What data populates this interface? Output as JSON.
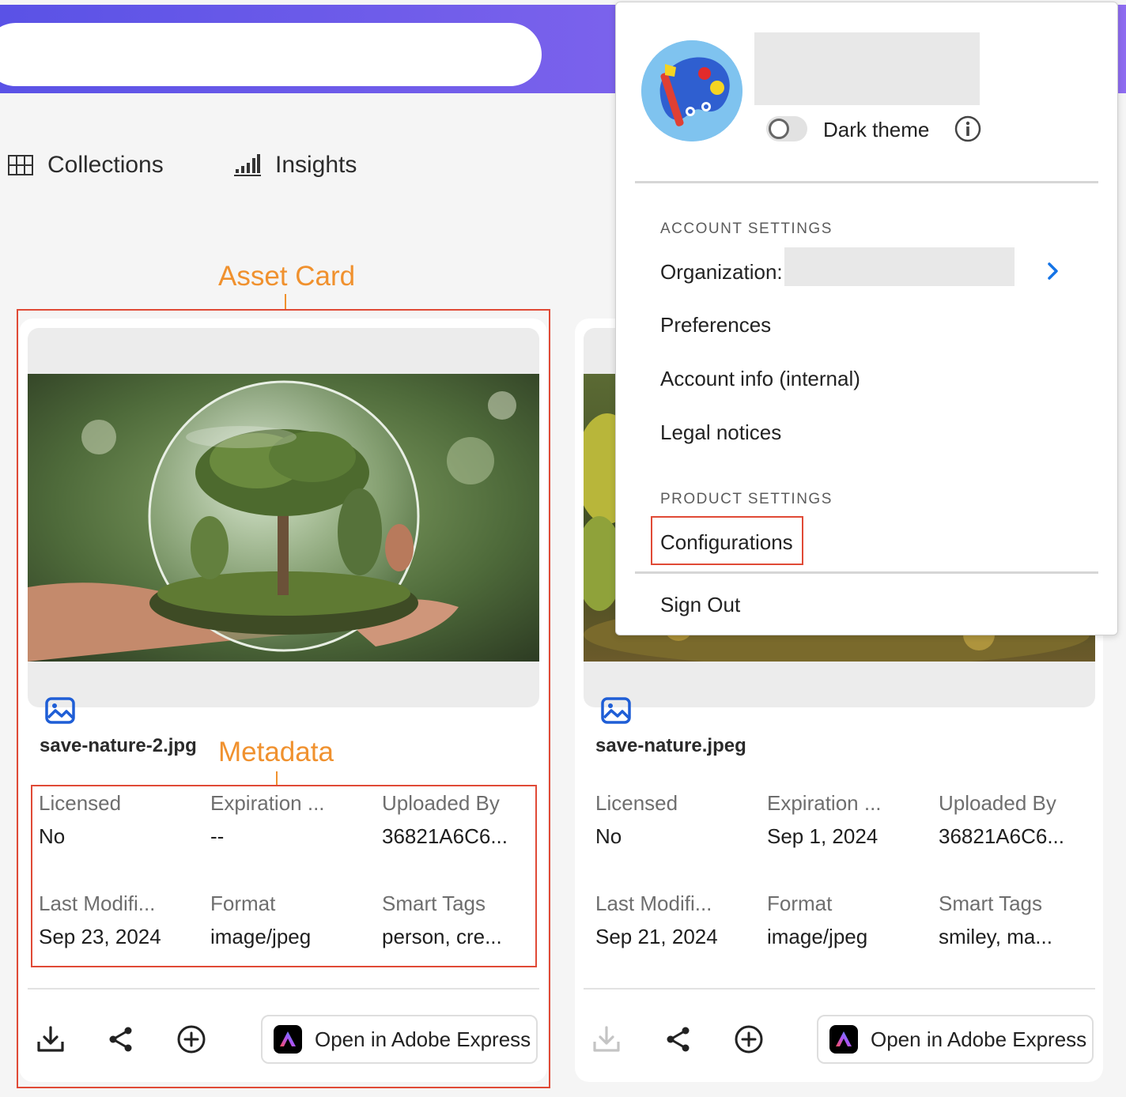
{
  "nav": {
    "collections": "Collections",
    "insights": "Insights"
  },
  "annotations": {
    "asset_card": "Asset Card",
    "metadata": "Metadata"
  },
  "cards": [
    {
      "filename": "save-nature-2.jpg",
      "meta": [
        {
          "label": "Licensed",
          "value": "No"
        },
        {
          "label": "Expiration ...",
          "value": "--"
        },
        {
          "label": "Uploaded By",
          "value": "36821A6C6..."
        },
        {
          "label": "Last Modifi...",
          "value": "Sep 23, 2024"
        },
        {
          "label": "Format",
          "value": "image/jpeg"
        },
        {
          "label": "Smart Tags",
          "value": "person, cre..."
        }
      ],
      "download_enabled": true,
      "express_label": "Open in Adobe Express"
    },
    {
      "filename": "save-nature.jpeg",
      "meta": [
        {
          "label": "Licensed",
          "value": "No"
        },
        {
          "label": "Expiration ...",
          "value": "Sep 1, 2024"
        },
        {
          "label": "Uploaded By",
          "value": "36821A6C6..."
        },
        {
          "label": "Last Modifi...",
          "value": "Sep 21, 2024"
        },
        {
          "label": "Format",
          "value": "image/jpeg"
        },
        {
          "label": "Smart Tags",
          "value": "smiley, ma..."
        }
      ],
      "download_enabled": false,
      "express_label": "Open in Adobe Express"
    }
  ],
  "menu": {
    "dark_theme_label": "Dark theme",
    "dark_theme_on": false,
    "account_settings_heading": "ACCOUNT SETTINGS",
    "organization_label": "Organization:",
    "preferences": "Preferences",
    "account_info": "Account info (internal)",
    "legal_notices": "Legal notices",
    "product_settings_heading": "PRODUCT SETTINGS",
    "configurations": "Configurations",
    "sign_out": "Sign Out"
  },
  "colors": {
    "topbar_gradient_start": "#5a52e6",
    "topbar_gradient_end": "#8e6cf0",
    "annotation_orange": "#f0912e",
    "highlight_red": "#e04a36",
    "link_blue": "#1473e6",
    "icon_blue": "#1f5ed6"
  },
  "icons": [
    "grid-icon",
    "bar-chart-icon",
    "image-type-icon",
    "download-icon",
    "share-icon",
    "add-circle-icon",
    "adobe-express-logo",
    "info-icon",
    "chevron-right-icon",
    "avatar-palette"
  ]
}
